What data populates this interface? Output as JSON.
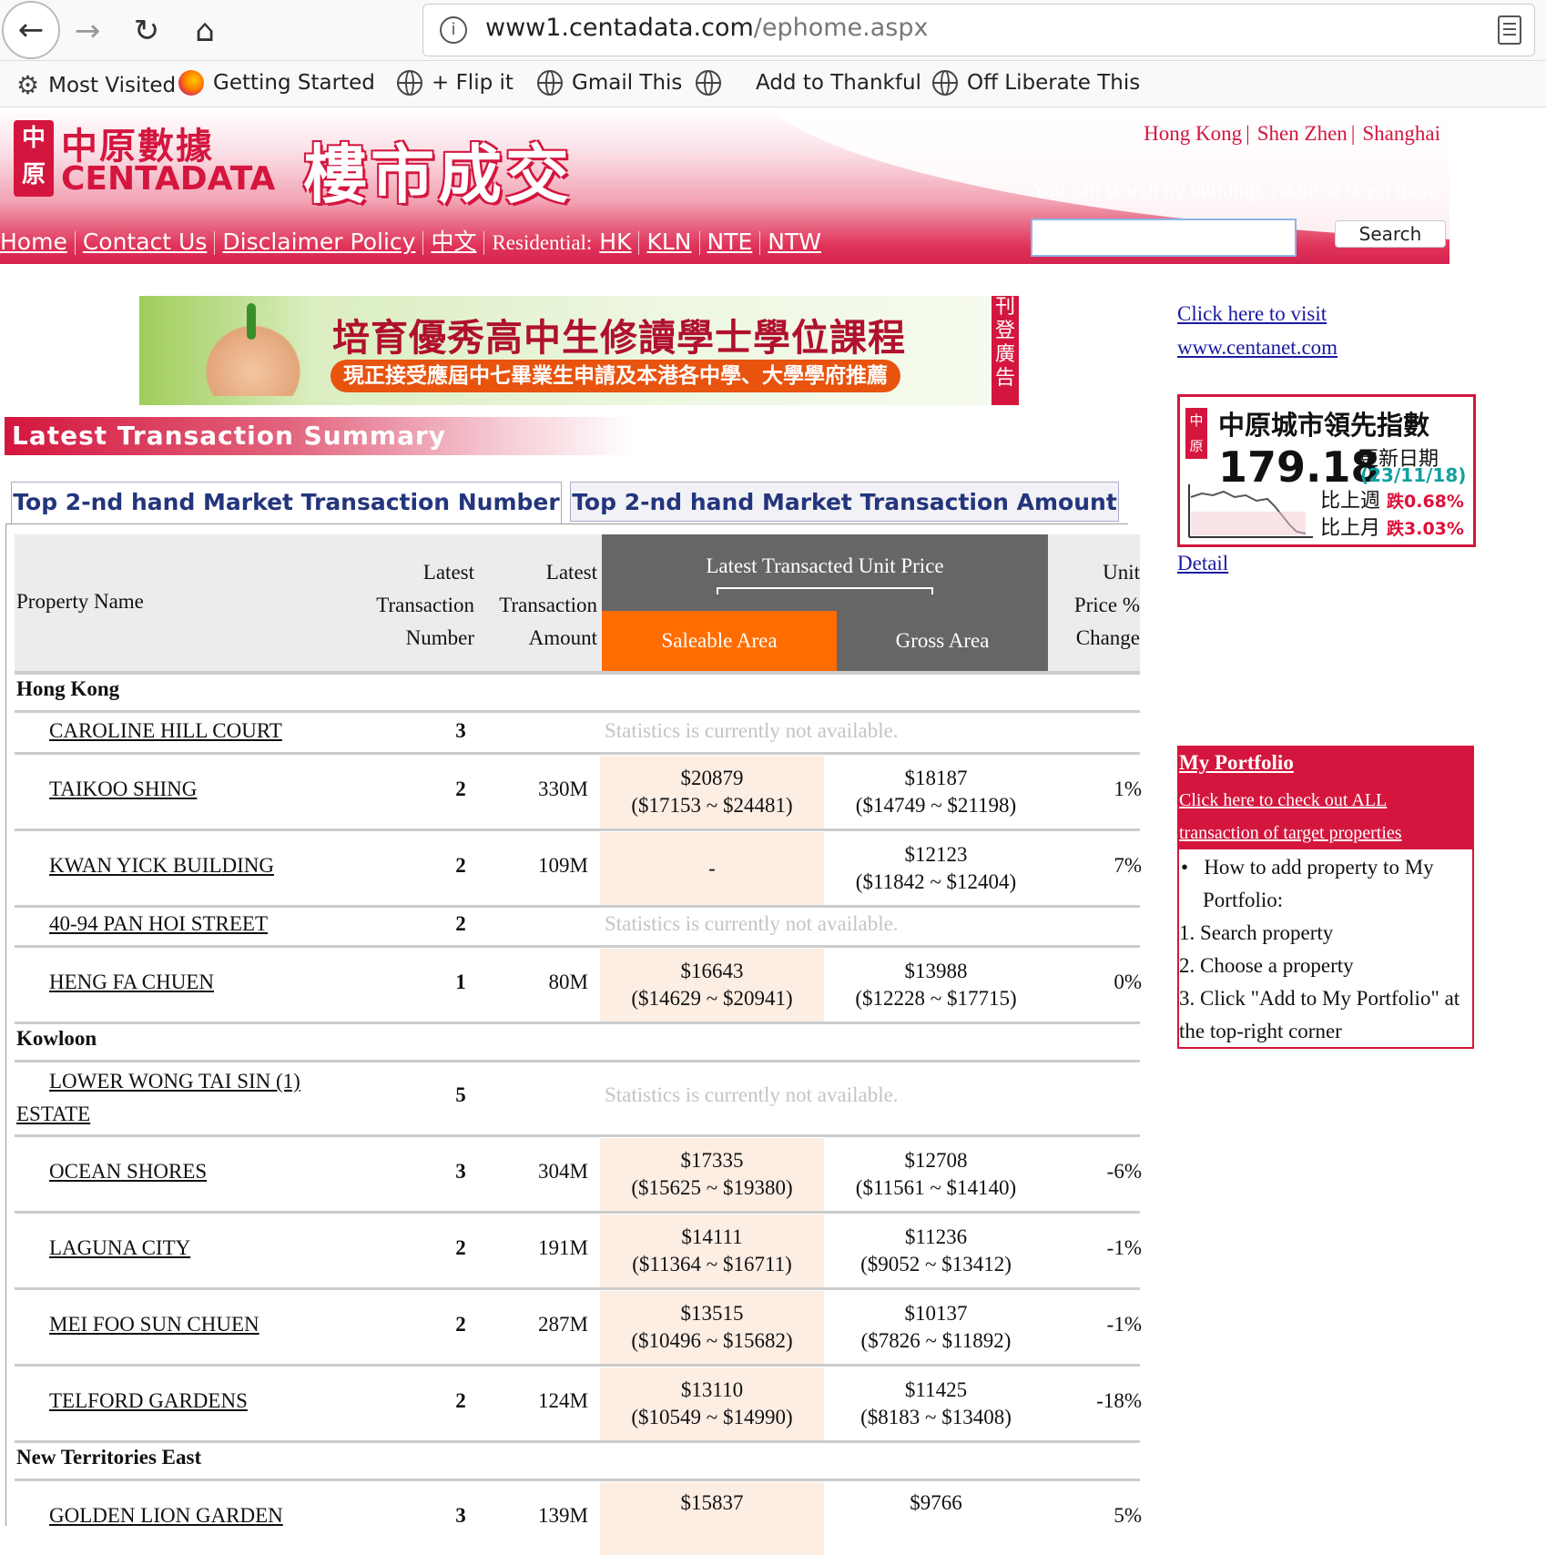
{
  "browser": {
    "url_host": "www1.centadata.com",
    "url_path": "/ephome.aspx",
    "bookmarks": [
      "Most Visited",
      "Getting Started",
      "+ Flip it",
      "Gmail This",
      "Add to Thankful",
      "Off Liberate This"
    ]
  },
  "header": {
    "logo_cn": "中原數據",
    "logo_en": "CENTADATA",
    "logo_seal": "中原",
    "title_cn": "樓市成交",
    "regions": [
      "Hong Kong",
      "Shen Zhen",
      "Shanghai"
    ],
    "search_hint": "You can search by building, estate or street name:",
    "nav": [
      "Home",
      "Contact Us",
      "Disclaimer Policy",
      "中文"
    ],
    "residential_label": "Residential:",
    "residential_links": [
      "HK",
      "KLN",
      "NTE",
      "NTW"
    ],
    "search_value": "",
    "search_button": "Search"
  },
  "ad": {
    "headline": "培育優秀高中生修讀學士學位課程",
    "subline": "現正接受應屆中七畢業生申請及本港各中學、大學學府推薦",
    "tag": "刊登廣告"
  },
  "section_title": "Latest Transaction Summary",
  "tabs": [
    "Top 2-nd hand Market Transaction Number",
    "Top 2-nd hand Market Transaction Amount"
  ],
  "table": {
    "headers": {
      "name": "Property Name",
      "number": [
        "Latest",
        "Transaction",
        "Number"
      ],
      "amount": [
        "Latest",
        "Transaction",
        "Amount"
      ],
      "price_title": "Latest Transacted Unit Price",
      "saleable": "Saleable Area",
      "gross": "Gross Area",
      "change": [
        "Unit",
        "Price %",
        "Change"
      ]
    },
    "na_text": "Statistics is currently not available.",
    "regions": [
      {
        "name": "Hong Kong",
        "rows": [
          {
            "name": "CAROLINE HILL COURT",
            "number": "3",
            "amount": "",
            "na": true
          },
          {
            "name": "TAIKOO SHING",
            "number": "2",
            "amount": "330M",
            "saleable": "$20879",
            "saleable_range": "($17153 ~ $24481)",
            "gross": "$18187",
            "gross_range": "($14749 ~ $21198)",
            "change": "1%"
          },
          {
            "name": "KWAN YICK BUILDING",
            "number": "2",
            "amount": "109M",
            "saleable": "-",
            "saleable_range": "",
            "gross": "$12123",
            "gross_range": "($11842 ~ $12404)",
            "change": "7%"
          },
          {
            "name": "40-94 PAN HOI STREET",
            "number": "2",
            "amount": "",
            "na": true
          },
          {
            "name": "HENG FA CHUEN",
            "number": "1",
            "amount": "80M",
            "saleable": "$16643",
            "saleable_range": "($14629 ~ $20941)",
            "gross": "$13988",
            "gross_range": "($12228 ~ $17715)",
            "change": "0%"
          }
        ]
      },
      {
        "name": "Kowloon",
        "rows": [
          {
            "name": "LOWER WONG TAI SIN (1) ESTATE",
            "number": "5",
            "amount": "",
            "na": true
          },
          {
            "name": "OCEAN SHORES",
            "number": "3",
            "amount": "304M",
            "saleable": "$17335",
            "saleable_range": "($15625 ~ $19380)",
            "gross": "$12708",
            "gross_range": "($11561 ~ $14140)",
            "change": "-6%"
          },
          {
            "name": "LAGUNA CITY",
            "number": "2",
            "amount": "191M",
            "saleable": "$14111",
            "saleable_range": "($11364 ~ $16711)",
            "gross": "$11236",
            "gross_range": "($9052 ~ $13412)",
            "change": "-1%"
          },
          {
            "name": "MEI FOO SUN CHUEN",
            "number": "2",
            "amount": "287M",
            "saleable": "$13515",
            "saleable_range": "($10496 ~ $15682)",
            "gross": "$10137",
            "gross_range": "($7826 ~ $11892)",
            "change": "-1%"
          },
          {
            "name": "TELFORD GARDENS",
            "number": "2",
            "amount": "124M",
            "saleable": "$13110",
            "saleable_range": "($10549 ~ $14990)",
            "gross": "$11425",
            "gross_range": "($8183 ~ $13408)",
            "change": "-18%"
          }
        ]
      },
      {
        "name": "New Territories East",
        "rows": [
          {
            "name": "GOLDEN LION GARDEN",
            "number": "3",
            "amount": "139M",
            "saleable": "$15837",
            "saleable_range": "",
            "gross": "$9766",
            "gross_range": "",
            "change": "5%"
          }
        ]
      }
    ]
  },
  "sidebar": {
    "visit_line1": "Click here to visit",
    "visit_line2": "www.centanet.com",
    "cci_title": "中原城市領先指數",
    "cci_value": "179.18",
    "cci_date_label": "更新日期",
    "cci_date": "(23/11/18)",
    "cci_week_label": "比上週",
    "cci_week_change": "跌0.68%",
    "cci_month_label": "比上月",
    "cci_month_change": "跌3.03%",
    "detail": "Detail",
    "portfolio_title": "My Portfolio",
    "portfolio_link": "Click here to check out ALL transaction of target properties",
    "portfolio_howto": "How to add property to My Portfolio:",
    "portfolio_steps": [
      "1. Search property",
      "2. Choose a property",
      "3. Click \"Add to My Portfolio\" at the top-right corner"
    ]
  }
}
